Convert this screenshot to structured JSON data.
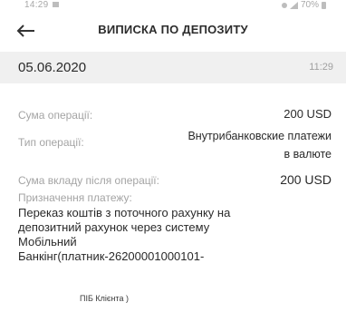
{
  "status_bar": {
    "time": "14:29",
    "battery": "70%"
  },
  "header": {
    "title": "ВИПИСКА ПО ДЕПОЗИТУ",
    "back_icon": "arrow-left-icon"
  },
  "operation": {
    "date": "05.06.2020",
    "time": "11:29",
    "amount_label": "Сума операції:",
    "amount_value": "200 USD",
    "type_label": "Тип операції:",
    "type_value": "Внутрибанковские платежи\nв валюте",
    "deposit_amount_label": "Сума вкладу після операції:",
    "deposit_amount_value": "200 USD",
    "purpose_label": "Призначення платежу:",
    "purpose_text": "Переказ коштів з поточного рахунку на\nдепозитний рахунок через систему\nМобільний\nБанкінг(платник-26200001000101-",
    "purpose_payer": "ПІБ Клієнта )"
  }
}
